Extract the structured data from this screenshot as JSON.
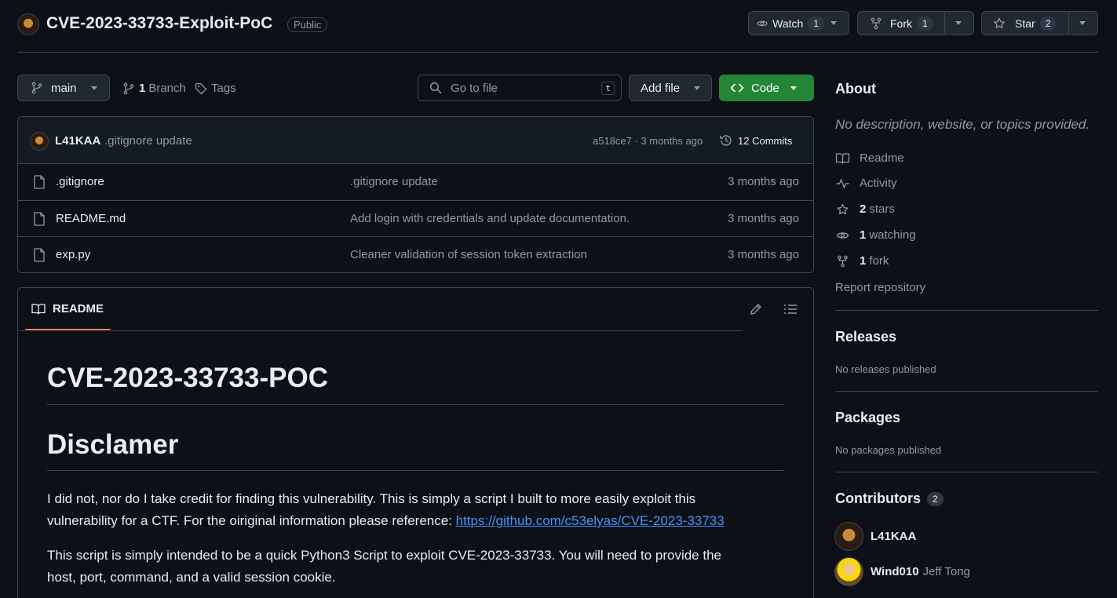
{
  "repo": {
    "name": "CVE-2023-33733-Exploit-PoC",
    "visibility": "Public"
  },
  "actions": {
    "watch_label": "Watch",
    "watch_count": "1",
    "fork_label": "Fork",
    "fork_count": "1",
    "star_label": "Star",
    "star_count": "2"
  },
  "toolbar": {
    "branch": "main",
    "branch_count": "1",
    "branch_label": "Branch",
    "tags_label": "Tags",
    "search_placeholder": "Go to file",
    "search_shortcut": "t",
    "add_file_label": "Add file",
    "code_label": "Code"
  },
  "latest_commit": {
    "author": "L41KAA",
    "message": ".gitignore update",
    "meta": "a518ce7 · 3 months ago",
    "commits_label": "12 Commits"
  },
  "files": [
    {
      "name": ".gitignore",
      "message": ".gitignore update",
      "time": "3 months ago"
    },
    {
      "name": "README.md",
      "message": "Add login with credentials and update documentation.",
      "time": "3 months ago"
    },
    {
      "name": "exp.py",
      "message": "Cleaner validation of session token extraction",
      "time": "3 months ago"
    }
  ],
  "readme": {
    "tab_label": "README",
    "h1": "CVE-2023-33733-POC",
    "h2": "Disclamer",
    "p1_line1": "I did not, nor do I take credit for finding this vulnerability. This is simply a script I built to more easily exploit this",
    "p1_line2": "vulnerability for a CTF. For the oiriginal information please reference: ",
    "p1_link": "https://github.com/c53elyas/CVE-2023-33733",
    "p2_line1": "This script is simply intended to be a quick Python3 Script to exploit CVE-2023-33733. You will need to provide the",
    "p2_line2": "host, port, command, and a valid session cookie."
  },
  "about": {
    "heading": "About",
    "description": "No description, website, or topics provided.",
    "readme": "Readme",
    "activity": "Activity",
    "stars_count": "2",
    "stars_label": "stars",
    "watching_count": "1",
    "watching_label": "watching",
    "fork_count": "1",
    "fork_label": "fork",
    "report": "Report repository"
  },
  "releases": {
    "heading": "Releases",
    "text": "No releases published"
  },
  "packages": {
    "heading": "Packages",
    "text": "No packages published"
  },
  "contributors": {
    "heading": "Contributors",
    "count": "2",
    "list": [
      {
        "login": "L41KAA",
        "name": ""
      },
      {
        "login": "Wind010",
        "name": "Jeff Tong"
      }
    ]
  },
  "colors": {
    "background": "#0d1117",
    "border": "#3d444d",
    "code_button": "#238636",
    "link": "#4493f8",
    "tab_underline": "#f78166"
  }
}
